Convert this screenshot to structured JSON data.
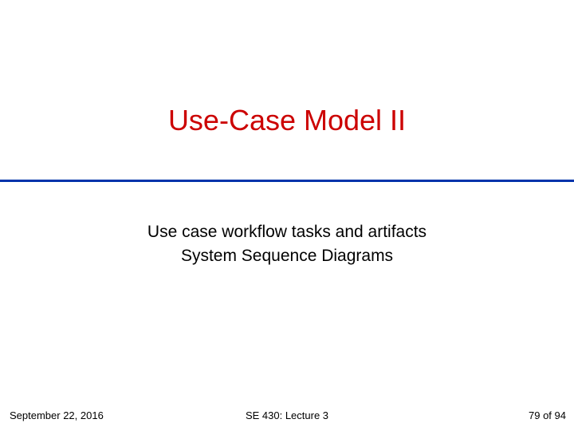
{
  "slide": {
    "title": "Use-Case Model II",
    "body_line1": "Use case workflow tasks and artifacts",
    "body_line2": "System Sequence Diagrams"
  },
  "footer": {
    "date": "September 22, 2016",
    "center": "SE 430: Lecture 3",
    "page": "79 of 94"
  }
}
